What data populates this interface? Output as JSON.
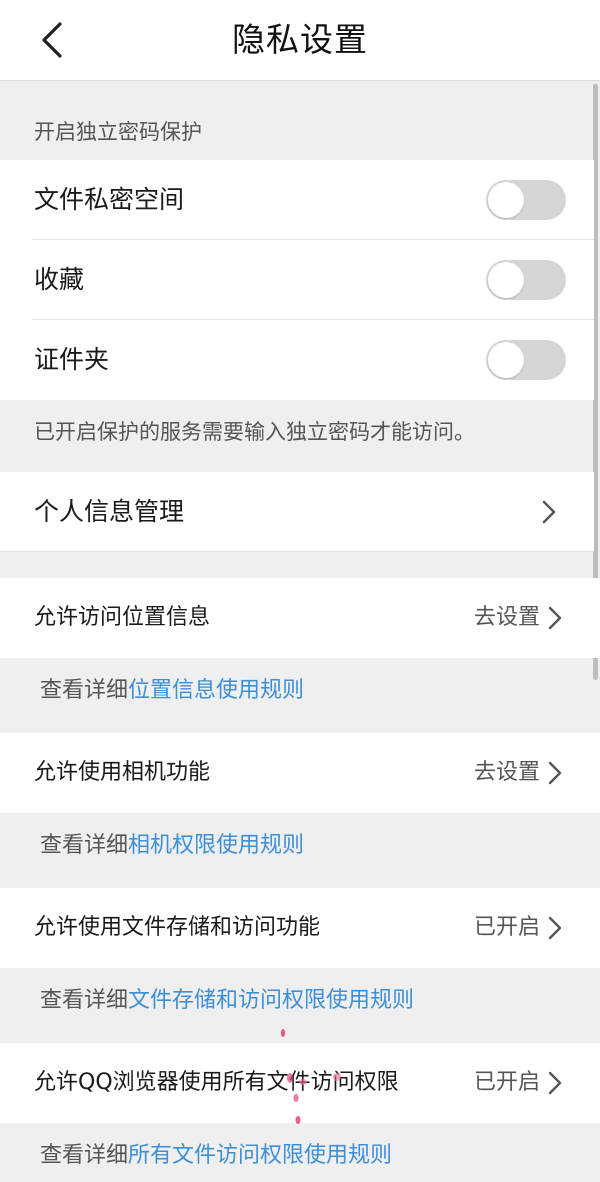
{
  "header": {
    "title": "隐私设置"
  },
  "protection": {
    "section_label": "开启独立密码保护",
    "items": [
      {
        "label": "文件私密空间",
        "enabled": false
      },
      {
        "label": "收藏",
        "enabled": false
      },
      {
        "label": "证件夹",
        "enabled": false
      }
    ],
    "hint": "已开启保护的服务需要输入独立密码才能访问。"
  },
  "personal_info": {
    "label": "个人信息管理"
  },
  "permissions": [
    {
      "label": "允许访问位置信息",
      "value": "去设置",
      "note_prefix": "查看详细",
      "note_link": "位置信息使用规则"
    },
    {
      "label": "允许使用相机功能",
      "value": "去设置",
      "note_prefix": "查看详细",
      "note_link": "相机权限使用规则"
    },
    {
      "label": "允许使用文件存储和访问功能",
      "value": "已开启",
      "note_prefix": "查看详细",
      "note_link": "文件存储和访问权限使用规则"
    },
    {
      "label": "允许QQ浏览器使用所有文件访问权限",
      "value": "已开启",
      "note_prefix": "查看详细",
      "note_link": "所有文件访问权限使用规则"
    }
  ],
  "colors": {
    "link": "#3d8fd8",
    "background": "#efefef",
    "toggle_off": "#d6d6d6"
  }
}
